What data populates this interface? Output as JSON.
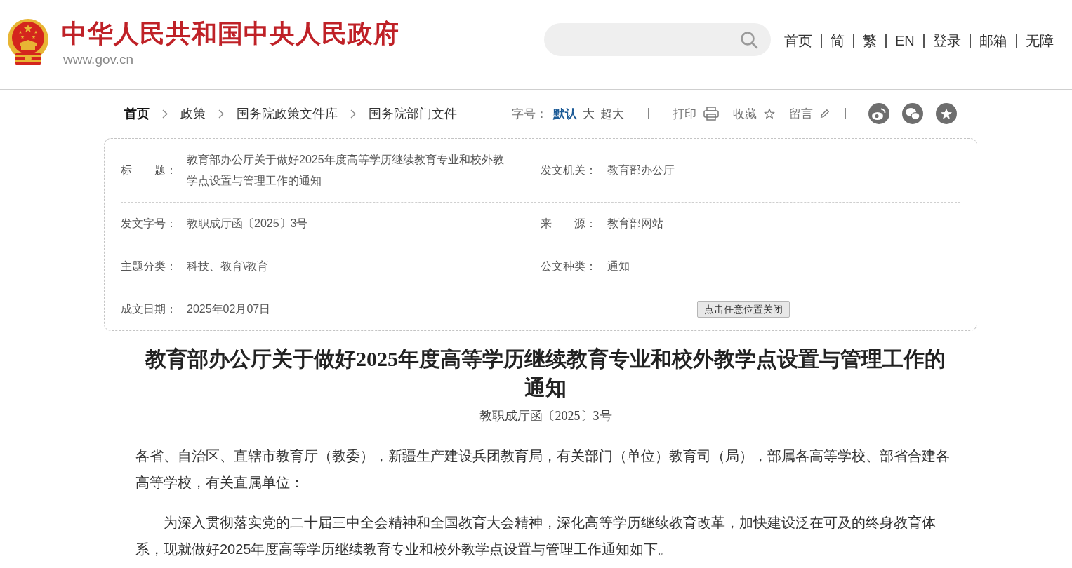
{
  "header": {
    "site_title": "中华人民共和国中央人民政府",
    "site_url": "www.gov.cn",
    "nav_links": [
      "首页",
      "简",
      "繁",
      "EN",
      "登录",
      "邮箱",
      "无障"
    ]
  },
  "breadcrumb": [
    "首页",
    "政策",
    "国务院政策文件库",
    "国务院部门文件"
  ],
  "toolbar": {
    "font_size_label": "字号：",
    "font_sizes": [
      {
        "label": "默认",
        "selected": true
      },
      {
        "label": "大",
        "selected": false
      },
      {
        "label": "超大",
        "selected": false
      }
    ],
    "actions": [
      {
        "label": "打印",
        "kind": "print"
      },
      {
        "label": "收藏",
        "kind": "bookmark"
      },
      {
        "label": "留言",
        "kind": "comment"
      }
    ]
  },
  "info_box": {
    "rows": [
      {
        "fields": [
          {
            "label": "标　　题：",
            "value": "教育部办公厅关于做好2025年度高等学历继续教育专业和校外教学点设置与管理工作的通知"
          },
          {
            "label": "发文机关：",
            "value": "教育部办公厅"
          }
        ]
      },
      {
        "fields": [
          {
            "label": "发文字号：",
            "value": "教职成厅函〔2025〕3号"
          },
          {
            "label": "来　　源：",
            "value": "教育部网站"
          }
        ]
      },
      {
        "fields": [
          {
            "label": "主题分类：",
            "value": "科技、教育\\教育"
          },
          {
            "label": "公文种类：",
            "value": "通知"
          }
        ]
      },
      {
        "fields": [
          {
            "label": "成文日期：",
            "value": "2025年02月07日"
          }
        ]
      }
    ],
    "close_button": "点击任意位置关闭"
  },
  "article": {
    "title": "教育部办公厅关于做好2025年度高等学历继续教育专业和校外教学点设置与管理工作的通知",
    "doc_number": "教职成厅函〔2025〕3号",
    "paragraphs": [
      {
        "kind": "salutation",
        "text": "各省、自治区、直辖市教育厅（教委），新疆生产建设兵团教育局，有关部门（单位）教育司（局），部属各高等学校、部省合建各高等学校，有关直属单位："
      },
      {
        "kind": "body",
        "text": "为深入贯彻落实党的二十届三中全会精神和全国教育大会精神，深化高等学历继续教育改革，加快建设泛在可及的终身教育体系，现就做好2025年度高等学历继续教育专业和校外教学点设置与管理工作通知如下。"
      }
    ]
  }
}
